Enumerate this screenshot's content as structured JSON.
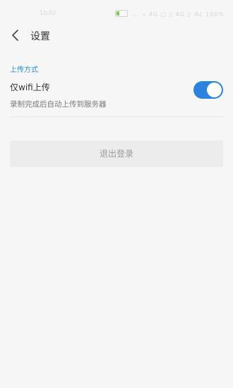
{
  "status_bar": {
    "time": "10:02",
    "right_text": "... ⌁ 4G ▢ ▯ 4G ▯ ⁂⁅ 100%",
    "icon": "battery-icon"
  },
  "header": {
    "title": "设置",
    "back_icon": "chevron-left-icon"
  },
  "upload_section": {
    "header": "上传方式",
    "wifi_only": {
      "label": "仅wifi上传",
      "description": "录制完成后自动上传到服务器",
      "enabled": true
    }
  },
  "logout_button": {
    "label": "退出登录"
  },
  "colors": {
    "accent": "#2c83dd",
    "section_header": "#2b8fd8",
    "background": "#f6f6f6"
  }
}
